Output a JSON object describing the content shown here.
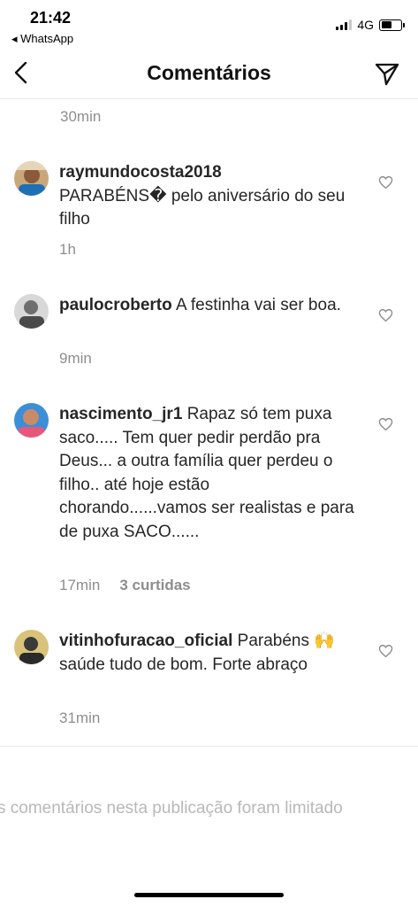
{
  "status_bar": {
    "time": "21:42",
    "back_app": "◂ WhatsApp",
    "network": "4G"
  },
  "nav": {
    "title": "Comentários"
  },
  "top_time": "30min",
  "comments": [
    {
      "username": "raymundocosta2018",
      "text": "PARABÉNS� pelo aniversário do seu filho",
      "time": "1h",
      "likes": ""
    },
    {
      "username": "paulocroberto",
      "text": "A festinha vai ser boa.",
      "time": "9min",
      "likes": ""
    },
    {
      "username": "nascimento_jr1",
      "text": "Rapaz só tem puxa saco..... Tem quer pedir perdão pra Deus... a outra família quer perdeu o filho.. até hoje estão chorando......vamos ser realistas e para de puxa SACO......",
      "time": "17min",
      "likes": "3 curtidas"
    },
    {
      "username": "vitinhofuracao_oficial",
      "text": "Parabéns 🙌 saúde tudo de bom. Forte abraço",
      "time": "31min",
      "likes": ""
    }
  ],
  "footer": {
    "limited_notice": "s comentários nesta publicação foram limitado"
  },
  "colors": {
    "text": "#262626",
    "secondary": "#8e8e8e",
    "divider": "#e8e8e8"
  },
  "icons": [
    "back-chevron-icon",
    "send-icon",
    "heart-icon"
  ]
}
